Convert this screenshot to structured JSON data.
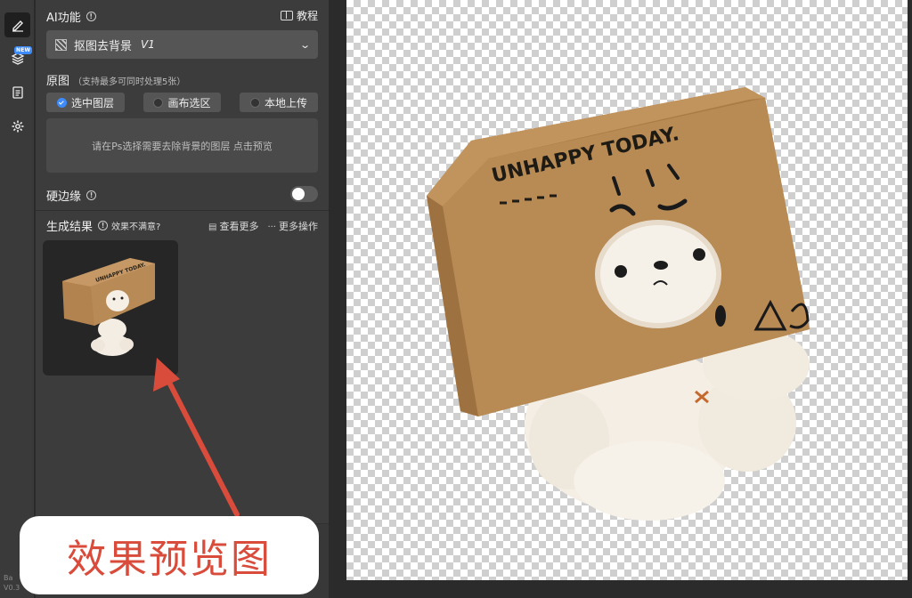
{
  "toolbar": {
    "new_badge": "NEW",
    "footer_line1": "Ba",
    "footer_line2": "V0.3"
  },
  "header": {
    "title": "AI功能",
    "tutorial_label": "教程"
  },
  "feature_select": {
    "value": "抠图去背景",
    "version": "V1"
  },
  "source": {
    "title": "原图",
    "hint": "（支持最多可同时处理5张）",
    "options": [
      "选中图层",
      "画布选区",
      "本地上传"
    ],
    "selected_index": 0,
    "dropzone_text": "请在Ps选择需要去除背景的图层 点击预览"
  },
  "hard_edge": {
    "label": "硬边缘",
    "enabled": false
  },
  "results": {
    "title": "生成结果",
    "unsatisfied": "效果不满意?",
    "view_more": "查看更多",
    "more_actions": "更多操作"
  },
  "product": {
    "box_text": "UNHAPPY TODAY."
  },
  "annotation": {
    "text": "效果预览图"
  },
  "colors": {
    "accent": "#3d8bfd",
    "annotation": "#d94b3a",
    "box": "#b78a57"
  }
}
